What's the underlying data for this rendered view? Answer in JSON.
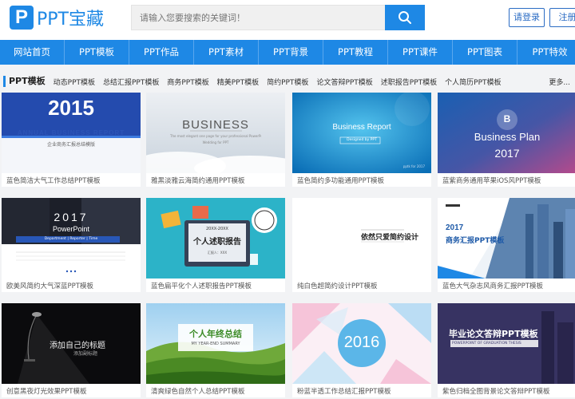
{
  "header": {
    "logo_mark": "P",
    "logo_text": "PPT宝藏",
    "search_placeholder": "请输入您要搜索的关键词！",
    "login_label": "请登录",
    "register_label": "注册"
  },
  "nav": [
    "网站首页",
    "PPT模板",
    "PPT作品",
    "PPT素材",
    "PPT背景",
    "PPT教程",
    "PPT课件",
    "PPT图表",
    "PPT特效"
  ],
  "categories": {
    "title": "PPT模板",
    "links": [
      "动态PPT模板",
      "总结汇报PPT模板",
      "商务PPT模板",
      "精美PPT模板",
      "简约PPT模板",
      "论文答辩PPT模板",
      "述职报告PPT模板",
      "个人简历PPT模板"
    ],
    "more": "更多..."
  },
  "cards": [
    {
      "caption": "蓝色简洁大气工作总结PPT模板",
      "t1": "2015",
      "t2": "ANNUAL BUSINESS REPORT",
      "t3": "企业商务汇报总结模版"
    },
    {
      "caption": "雅黑淡雅云海简约通用PPT模板",
      "t1": "BUSINESS",
      "t2": "The most elegant one page for your professional PowerPoint template",
      "t3": "Wedding for PPT"
    },
    {
      "caption": "蓝色简约多功能通用PPT模板",
      "t1": "Business Report",
      "t2": "Designed by PPT",
      "t3": "pptk for 2017"
    },
    {
      "caption": "蓝紫商务通用苹果iOS风PPT模板",
      "t1": "B",
      "t2": "Business Plan",
      "t3": "2017"
    },
    {
      "caption": "欧美风简约大气深蓝PPT模板",
      "t1": "2017",
      "t2": "PowerPoint",
      "t3": "Department  |  Reporter  |  Time"
    },
    {
      "caption": "蓝色扁平化个人述职报告PPT模板",
      "t1": "20XX-20XX",
      "t2": "个人述职报告",
      "t3": "汇报人：XXX"
    },
    {
      "caption": "纯白色超简约设计PPT模板",
      "t1": "依然只爱简约设计",
      "t2": "",
      "t3": ""
    },
    {
      "caption": "蓝色大气杂志风商务汇报PPT模板",
      "t1": "2017",
      "t2": "商务汇报PPT模板",
      "t3": ""
    },
    {
      "caption": "创意黑夜灯光效果PPT模板",
      "t1": "添加自己的标题",
      "t2": "添加副标题",
      "t3": ""
    },
    {
      "caption": "清爽绿色自然个人总结PPT模板",
      "t1": "个人年终总结",
      "t2": "MY YEAR-END SUMMARY",
      "t3": ""
    },
    {
      "caption": "粉蓝半透工作总结汇报PPT模板",
      "t1": "2016",
      "t2": "",
      "t3": ""
    },
    {
      "caption": "紫色归档全图背景论文答辩PPT模板",
      "t1": "毕业论文答辩PPT模板",
      "t2": "POWERPOINT OF GRADUATION THESIS",
      "t3": ""
    }
  ],
  "colors": {
    "brand": "#1e88e5",
    "nav_divider": "#5aa7ee"
  }
}
